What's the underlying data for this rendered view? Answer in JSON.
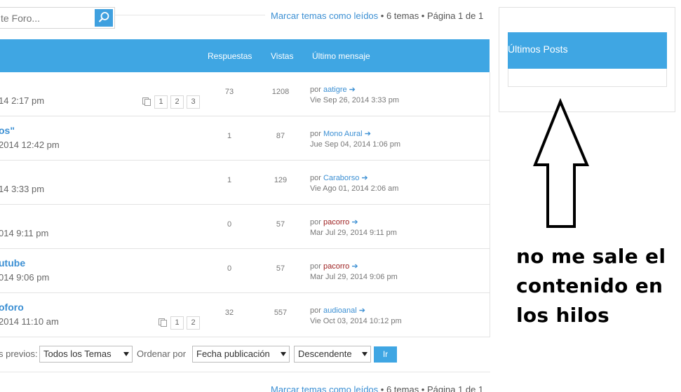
{
  "search": {
    "placeholder": "te Foro..."
  },
  "pagination": {
    "mark_read": "Marcar temas como leídos",
    "summary": " • 6 temas • Página 1 de 1"
  },
  "table": {
    "headers": {
      "replies": "Respuestas",
      "views": "Vistas",
      "last_post": "Último mensaje"
    },
    "rows": [
      {
        "title": "",
        "date": "14 2:17 pm",
        "pages": [
          "1",
          "2",
          "3"
        ],
        "replies": "73",
        "views": "1208",
        "by": "por",
        "user": "aatigre",
        "user_color": "#3b8fd3",
        "last_date": "Vie Sep 26, 2014 3:33 pm"
      },
      {
        "title": "os\"",
        "date": "2014 12:42 pm",
        "pages": [],
        "replies": "1",
        "views": "87",
        "by": "por",
        "user": "Mono Aural",
        "user_color": "#3b8fd3",
        "last_date": "Jue Sep 04, 2014 1:06 pm"
      },
      {
        "title": "",
        "date": "14 3:33 pm",
        "pages": [],
        "replies": "1",
        "views": "129",
        "by": "por",
        "user": "Caraborso",
        "user_color": "#3b8fd3",
        "last_date": "Vie Ago 01, 2014 2:06 am"
      },
      {
        "title": "",
        "date": "014 9:11 pm",
        "pages": [],
        "replies": "0",
        "views": "57",
        "by": "por",
        "user": "pacorro",
        "user_color": "#9b1c1c",
        "last_date": "Mar Jul 29, 2014 9:11 pm"
      },
      {
        "title": "utube",
        "date": "014 9:06 pm",
        "pages": [],
        "replies": "0",
        "views": "57",
        "by": "por",
        "user": "pacorro",
        "user_color": "#9b1c1c",
        "last_date": "Mar Jul 29, 2014 9:06 pm"
      },
      {
        "title": "oforo",
        "date": "2014 11:10 am",
        "pages": [
          "1",
          "2"
        ],
        "replies": "32",
        "views": "557",
        "by": "por",
        "user": "audioanal",
        "user_color": "#3b8fd3",
        "last_date": "Vie Oct 03, 2014 10:12 pm"
      }
    ]
  },
  "filters": {
    "prev_label": "s previos:",
    "topics_select": "Todos los Temas",
    "order_label": "Ordenar por",
    "order_select": "Fecha publicación",
    "direction_select": "Descendente",
    "go_label": "Ir"
  },
  "sidebar": {
    "title": "Últimos Posts"
  },
  "annotation": {
    "line1": "no me sale el",
    "line2": "contenido en",
    "line3": "los hilos"
  },
  "colors": {
    "accent": "#3fa6e3",
    "link": "#3b8fd3",
    "user_red": "#9b1c1c"
  }
}
